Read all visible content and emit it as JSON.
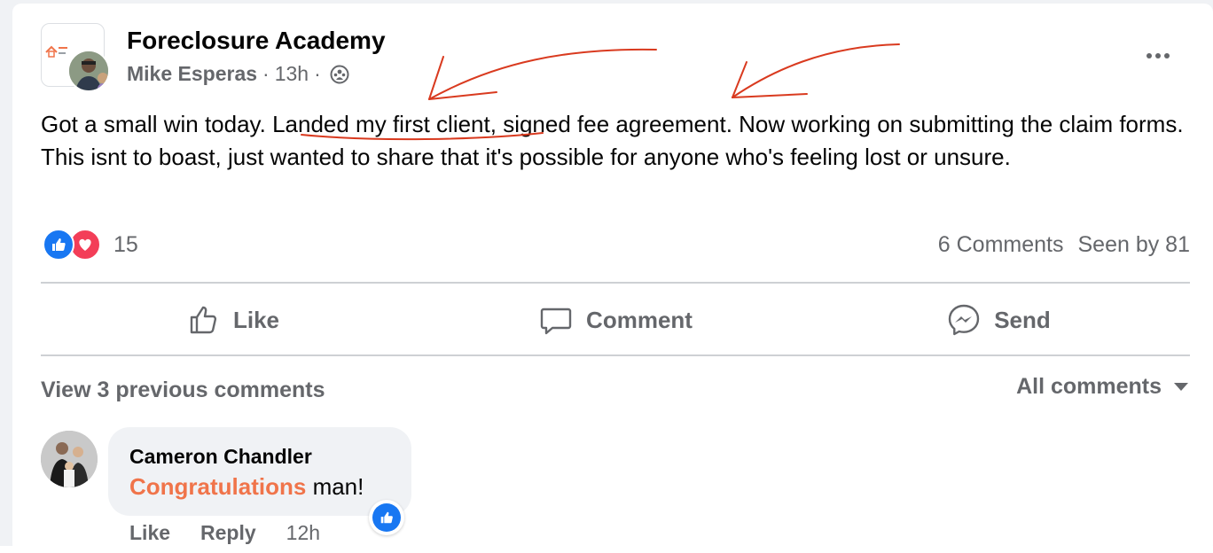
{
  "post": {
    "group_name": "Foreclosure Academy",
    "logo_text": "FORECLOSURE ACADEMY",
    "author": "Mike Esperas",
    "time": "13h",
    "separator": "·",
    "audience_icon": "group-members-icon",
    "text_before": "Got a small win today. ",
    "text_highlight": "Landed my first client",
    "text_after": ", signed fee agreement. Now working on submitting the claim forms. This isnt to boast, just wanted to share that it's possible for anyone who's feeling lost or unsure."
  },
  "reactions": {
    "icons": [
      "like-reaction-icon",
      "love-reaction-icon"
    ],
    "count": "15",
    "comments": "6 Comments",
    "seen_by": "Seen by 81"
  },
  "actions": {
    "like": "Like",
    "comment": "Comment",
    "send": "Send"
  },
  "comments_section": {
    "view_previous": "View 3 previous comments",
    "filter": "All comments"
  },
  "comment": {
    "author": "Cameron Chandler",
    "highlight": "Congratulations",
    "text": " man!",
    "like_label": "Like",
    "reply_label": "Reply",
    "time": "12h"
  },
  "colors": {
    "accent": "#1877f2",
    "love": "#f33e58",
    "secondary_text": "#65676b",
    "annotation_red": "#d93a1f",
    "comment_highlight": "#f0744a"
  }
}
